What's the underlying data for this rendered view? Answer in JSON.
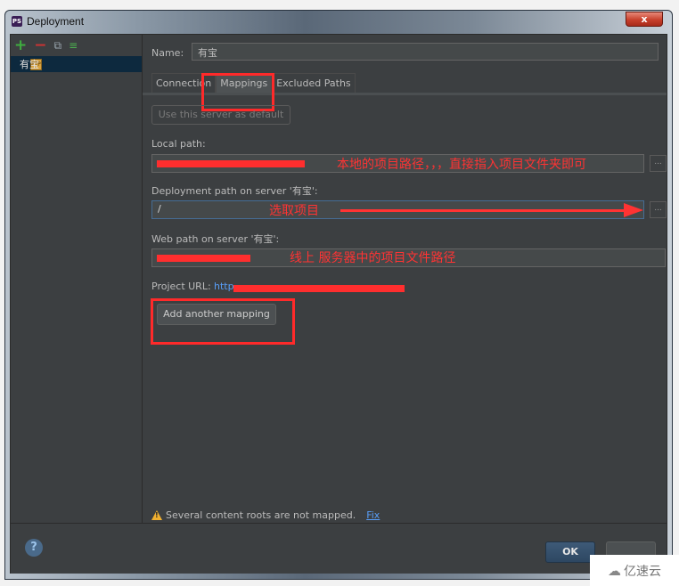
{
  "window": {
    "title": "Deployment",
    "app_icon": "PS",
    "close_label": "x"
  },
  "sidebar": {
    "toolbar": {
      "add": "+",
      "remove": "−",
      "copy": "⧉",
      "default": "≡"
    },
    "servers": [
      {
        "label": "有宝",
        "selected": true
      }
    ]
  },
  "form": {
    "name_label": "Name:",
    "name_value": "有宝",
    "tabs": [
      {
        "label": "Connection",
        "active": false
      },
      {
        "label": "Mappings",
        "active": true
      },
      {
        "label": "Excluded Paths",
        "active": false
      }
    ],
    "default_button": "Use this server as default",
    "local_path_label": "Local path:",
    "local_path_value": "",
    "deployment_path_label": "Deployment path on server '有宝':",
    "deployment_path_value": "/",
    "web_path_label": "Web path on server '有宝':",
    "web_path_value": "",
    "browse_label": "...",
    "project_url_label": "Project URL:",
    "project_url_value": "http",
    "add_mapping_button": "Add another mapping",
    "warning_text": "Several content roots are not mapped.",
    "fix_link": "Fix"
  },
  "annotations": {
    "local_path_note": "本地的项目路径，，，直接指入项目文件夹即可",
    "deployment_path_note": "选取项目",
    "web_path_note": "线上 服务器中的项目文件路径",
    "highlight_color": "#ff2a2a"
  },
  "footer": {
    "help": "?",
    "ok_label": "OK",
    "cancel_label": ""
  },
  "watermark": {
    "icon": "cloud-logo",
    "text": "亿速云"
  }
}
